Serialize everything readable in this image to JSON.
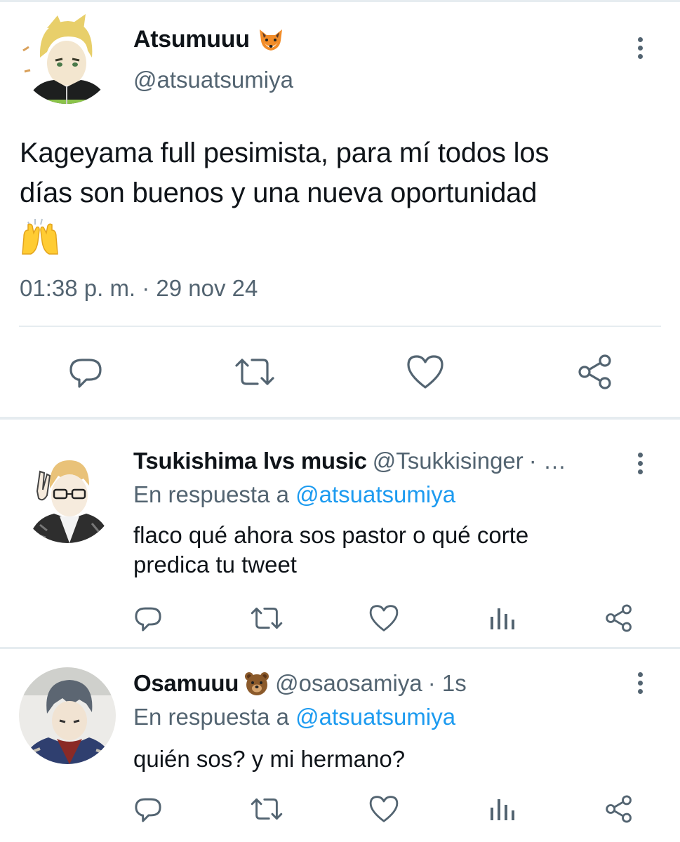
{
  "main_tweet": {
    "display_name": "Atsumuuu",
    "name_emoji": "fox-emoji",
    "handle": "@atsuatsumiya",
    "text_lines": [
      "Kageyama full pesimista, para mí todos los",
      "días son buenos y una nueva oportunidad"
    ],
    "text_emoji": "raising-hands-emoji",
    "timestamp": "01:38 p. m. · 29 nov 24",
    "actions": [
      "reply-icon",
      "retweet-icon",
      "like-icon",
      "share-icon"
    ]
  },
  "replies": [
    {
      "display_name": "Tsukishima lvs music",
      "handle": "@Tsukkisinger",
      "meta": "· …",
      "reply_prefix": "En respuesta a",
      "reply_mention": "@atsuatsumiya",
      "text_lines": [
        "flaco qué ahora sos pastor o qué corte",
        "predica tu tweet"
      ],
      "actions": [
        "reply-icon",
        "retweet-icon",
        "like-icon",
        "analytics-icon",
        "share-icon"
      ]
    },
    {
      "display_name": "Osamuuu",
      "name_emoji": "bear-emoji",
      "handle": "@osaosamiya",
      "meta": "· 1s",
      "reply_prefix": "En respuesta a",
      "reply_mention": "@atsuatsumiya",
      "text_lines": [
        "quién sos? y mi hermano?"
      ],
      "actions": [
        "reply-icon",
        "retweet-icon",
        "like-icon",
        "analytics-icon",
        "share-icon"
      ]
    }
  ],
  "colors": {
    "text": "#0f1419",
    "secondary": "#536471",
    "link": "#1d9bf0",
    "divider": "#e6ecf0"
  }
}
